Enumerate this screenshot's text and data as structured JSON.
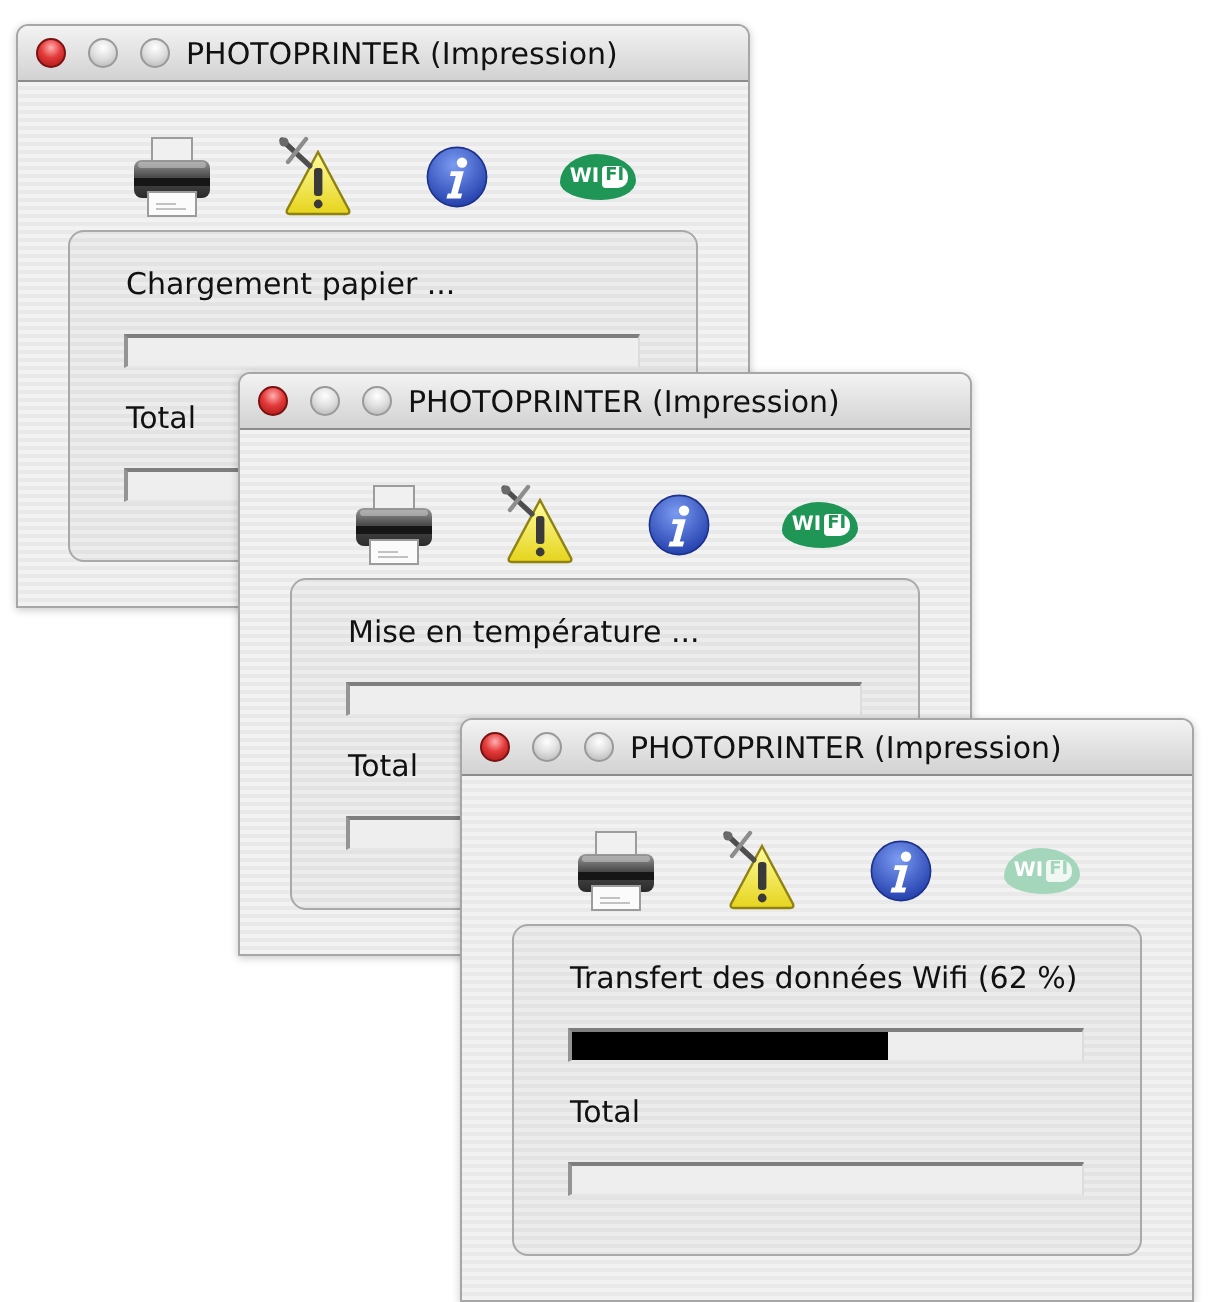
{
  "windows": [
    {
      "title": "PHOTOPRINTER (Impression)",
      "status_icons": [
        {
          "kind": "printer",
          "active": true
        },
        {
          "kind": "warning",
          "active": true
        },
        {
          "kind": "info",
          "active": true
        },
        {
          "kind": "wifi",
          "active": true,
          "texts": [
            "WI",
            "FI"
          ]
        }
      ],
      "progress": [
        {
          "label": "Chargement papier ..."
        },
        {
          "label": "Total"
        }
      ]
    },
    {
      "title": "PHOTOPRINTER (Impression)",
      "status_icons": [
        {
          "kind": "printer",
          "active": true
        },
        {
          "kind": "warning",
          "active": true
        },
        {
          "kind": "info",
          "active": true
        },
        {
          "kind": "wifi",
          "active": true,
          "texts": [
            "WI",
            "FI"
          ]
        }
      ],
      "progress": [
        {
          "label": "Mise en température ..."
        },
        {
          "label": "Total"
        }
      ]
    },
    {
      "title": "PHOTOPRINTER (Impression)",
      "status_icons": [
        {
          "kind": "printer",
          "active": true
        },
        {
          "kind": "warning",
          "active": true
        },
        {
          "kind": "info",
          "active": true
        },
        {
          "kind": "wifi",
          "active": false,
          "texts": [
            "WI",
            "FI"
          ]
        }
      ],
      "progress": [
        {
          "label": "Transfert des données Wifi (62 %)",
          "level": 0.62
        },
        {
          "label": "Total"
        }
      ]
    }
  ]
}
